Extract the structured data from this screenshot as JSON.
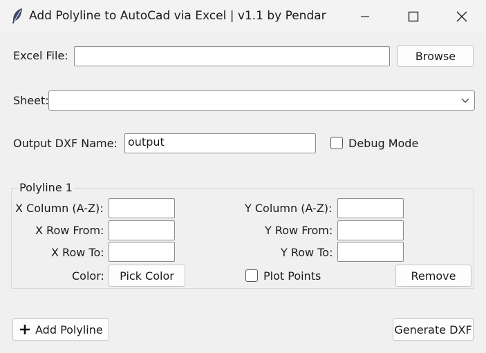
{
  "window": {
    "title": "Add Polyline to AutoCad via Excel | v1.1 by Pendar",
    "icon": "feather-icon"
  },
  "excel_file": {
    "label": "Excel File:",
    "value": "",
    "browse_label": "Browse"
  },
  "sheet": {
    "label": "Sheet:",
    "selected": ""
  },
  "output": {
    "label": "Output DXF Name:",
    "value": "output",
    "debug_label": "Debug Mode",
    "debug_checked": false
  },
  "polyline": {
    "group_title": "Polyline 1",
    "x_column_label": "X Column (A-Z):",
    "x_column_value": "",
    "x_row_from_label": "X Row From:",
    "x_row_from_value": "",
    "x_row_to_label": "X Row To:",
    "x_row_to_value": "",
    "y_column_label": "Y Column (A-Z):",
    "y_column_value": "",
    "y_row_from_label": "Y Row From:",
    "y_row_from_value": "",
    "y_row_to_label": "Y Row To:",
    "y_row_to_value": "",
    "color_label": "Color:",
    "pick_color_label": "Pick Color",
    "plot_points_label": "Plot Points",
    "plot_points_checked": false,
    "remove_label": "Remove"
  },
  "footer": {
    "add_polyline_label": "Add Polyline",
    "generate_label": "Generate DXF"
  }
}
